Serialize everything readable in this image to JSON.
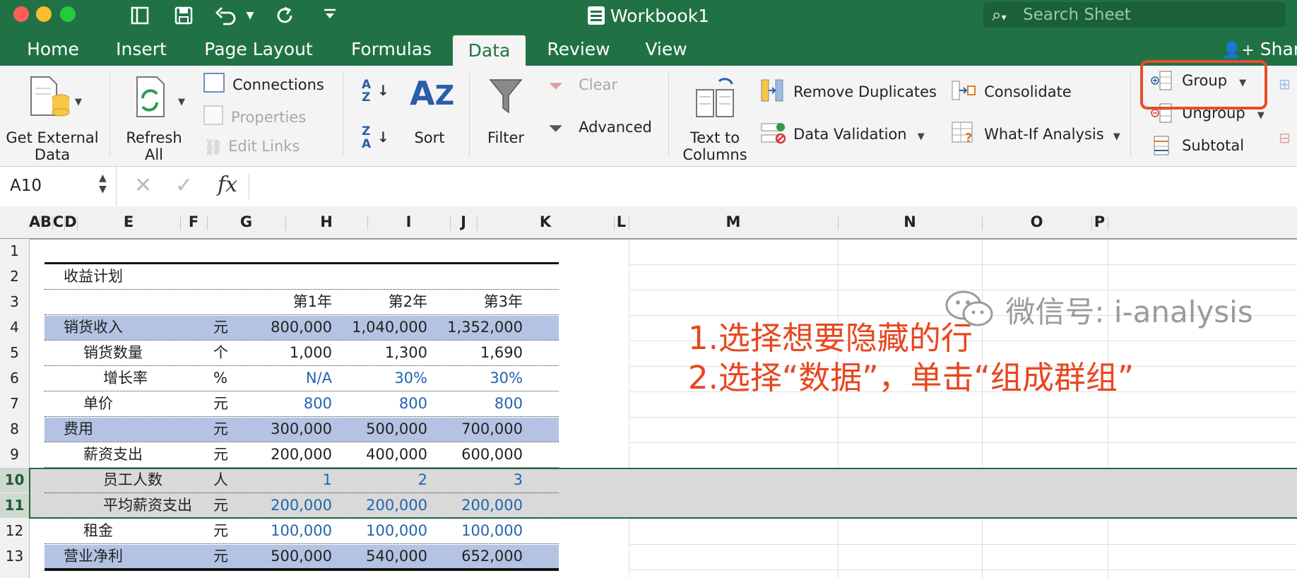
{
  "window": {
    "title": "Workbook1",
    "search_placeholder": "Search Sheet",
    "brand_color": "#207245"
  },
  "tabs": [
    {
      "label": "Home"
    },
    {
      "label": "Insert"
    },
    {
      "label": "Page Layout"
    },
    {
      "label": "Formulas"
    },
    {
      "label": "Data",
      "active": true
    },
    {
      "label": "Review"
    },
    {
      "label": "View"
    }
  ],
  "share_label": "Share",
  "ribbon": {
    "get_external_data": "Get External Data",
    "refresh_all": "Refresh All",
    "connections": "Connections",
    "properties": "Properties",
    "edit_links": "Edit Links",
    "sort": "Sort",
    "filter": "Filter",
    "clear": "Clear",
    "advanced": "Advanced",
    "text_to_columns": "Text to Columns",
    "remove_duplicates": "Remove Duplicates",
    "data_validation": "Data Validation",
    "consolidate": "Consolidate",
    "what_if_analysis": "What-If Analysis",
    "group": "Group",
    "ungroup": "Ungroup",
    "subtotal": "Subtotal",
    "highlight_color": "#e74c2b"
  },
  "formula_bar": {
    "name_box": "A10",
    "fx_label": "fx",
    "formula": ""
  },
  "columns": [
    "A",
    "B",
    "C",
    "D",
    "E",
    "F",
    "G",
    "H",
    "I",
    "J",
    "K",
    "L",
    "M",
    "N",
    "O",
    "P"
  ],
  "selected_rows": [
    10,
    11
  ],
  "sheet": {
    "title": "收益计划",
    "years": [
      "第1年",
      "第2年",
      "第3年"
    ],
    "rows": [
      {
        "row": 4,
        "label": "销货收入",
        "indent": 0,
        "unit": "元",
        "values": [
          "800,000",
          "1,040,000",
          "1,352,000"
        ],
        "blue": false,
        "band": true
      },
      {
        "row": 5,
        "label": "销货数量",
        "indent": 1,
        "unit": "个",
        "values": [
          "1,000",
          "1,300",
          "1,690"
        ],
        "blue": false,
        "band": false
      },
      {
        "row": 6,
        "label": "增长率",
        "indent": 2,
        "unit": "%",
        "values": [
          "N/A",
          "30%",
          "30%"
        ],
        "blue": true,
        "band": false
      },
      {
        "row": 7,
        "label": "单价",
        "indent": 1,
        "unit": "元",
        "values": [
          "800",
          "800",
          "800"
        ],
        "blue": true,
        "band": false
      },
      {
        "row": 8,
        "label": "费用",
        "indent": 0,
        "unit": "元",
        "values": [
          "300,000",
          "500,000",
          "700,000"
        ],
        "blue": false,
        "band": true
      },
      {
        "row": 9,
        "label": "薪资支出",
        "indent": 1,
        "unit": "元",
        "values": [
          "200,000",
          "400,000",
          "600,000"
        ],
        "blue": false,
        "band": false
      },
      {
        "row": 10,
        "label": "员工人数",
        "indent": 2,
        "unit": "人",
        "values": [
          "1",
          "2",
          "3"
        ],
        "blue": true,
        "band": false
      },
      {
        "row": 11,
        "label": "平均薪资支出",
        "indent": 2,
        "unit": "元",
        "values": [
          "200,000",
          "200,000",
          "200,000"
        ],
        "blue": true,
        "band": false
      },
      {
        "row": 12,
        "label": "租金",
        "indent": 1,
        "unit": "元",
        "values": [
          "100,000",
          "100,000",
          "100,000"
        ],
        "blue": true,
        "band": false
      },
      {
        "row": 13,
        "label": "营业净利",
        "indent": 0,
        "unit": "元",
        "values": [
          "500,000",
          "540,000",
          "652,000"
        ],
        "blue": false,
        "band": true
      }
    ],
    "band_color": "#b4c3e3",
    "selection_color": "#d9d9d9",
    "input_color": "#2264b0"
  },
  "annotation": {
    "line1": "1.选择想要隐藏的行",
    "line2": "2.选择“数据”，单击“组成群组”",
    "color": "#e7471f"
  },
  "watermark": "微信号: i-analysis"
}
